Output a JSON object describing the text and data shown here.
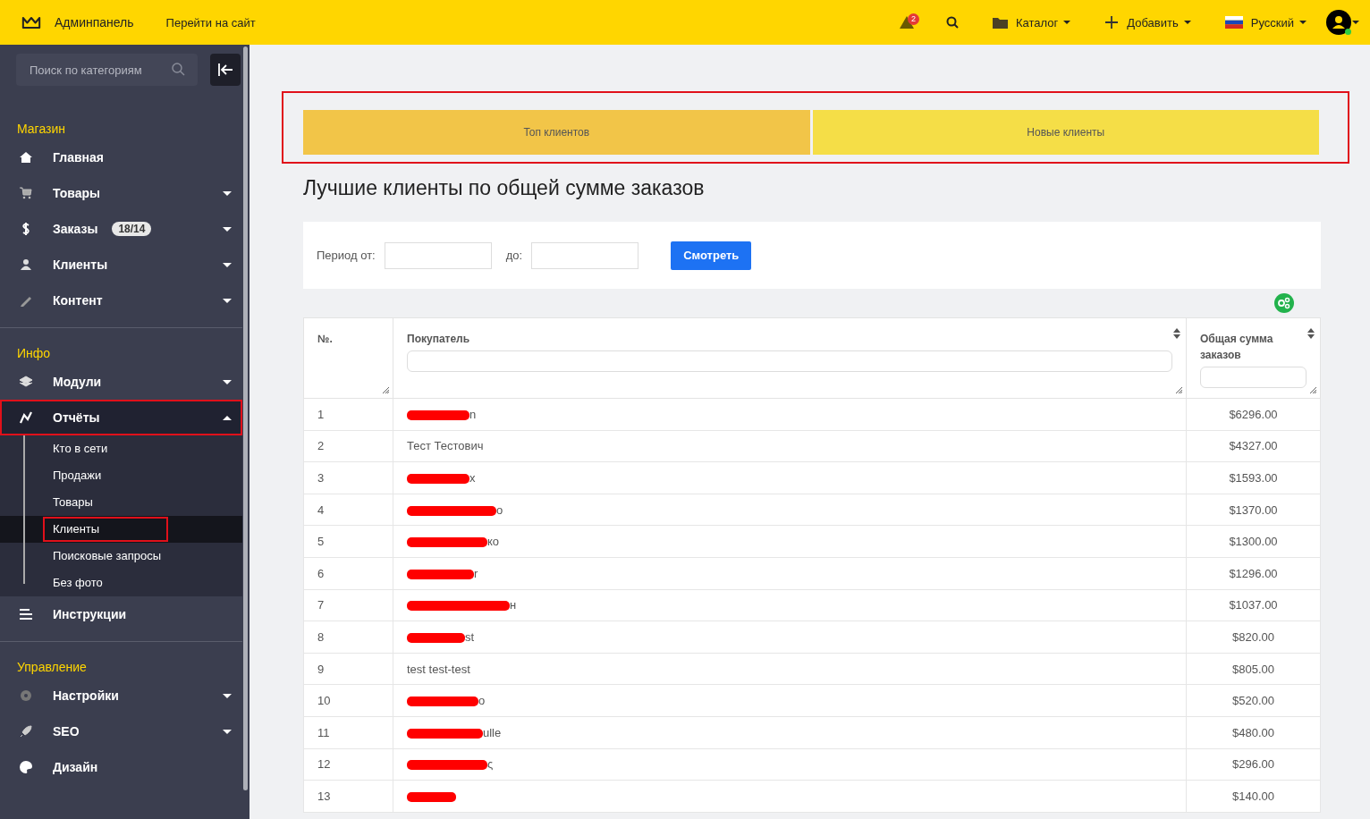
{
  "topbar": {
    "brand": "Админпанель",
    "site_link": "Перейти на сайт",
    "alerts_count": "2",
    "menus": [
      {
        "kind": "catalog",
        "label": "Каталог"
      },
      {
        "kind": "add",
        "label": "Добавить"
      },
      {
        "kind": "language",
        "label": "Русский"
      }
    ],
    "user_online": true
  },
  "sidebar": {
    "search_placeholder": "Поиск по категориям",
    "sections": [
      {
        "title": "Магазин",
        "items": [
          {
            "label": "Главная",
            "has_caret": false,
            "expanded": false,
            "annotated": false
          },
          {
            "label": "Товары",
            "has_caret": true,
            "expanded": false,
            "annotated": false
          },
          {
            "label": "Заказы",
            "badge": "18/14",
            "has_caret": true,
            "expanded": false,
            "annotated": false
          },
          {
            "label": "Клиенты",
            "has_caret": true,
            "expanded": false,
            "annotated": false
          },
          {
            "label": "Контент",
            "has_caret": true,
            "expanded": false,
            "annotated": false
          }
        ]
      },
      {
        "title": "Инфо",
        "items": [
          {
            "label": "Модули",
            "has_caret": true,
            "expanded": false,
            "annotated": false
          },
          {
            "label": "Отчёты",
            "has_caret": true,
            "expanded": true,
            "annotated": true,
            "children": [
              {
                "label": "Кто в сети",
                "selected": false,
                "annotated": false
              },
              {
                "label": "Продажи",
                "selected": false,
                "annotated": false
              },
              {
                "label": "Товары",
                "selected": false,
                "annotated": false
              },
              {
                "label": "Клиенты",
                "selected": true,
                "annotated": true
              },
              {
                "label": "Поисковые запросы",
                "selected": false,
                "annotated": false
              },
              {
                "label": "Без фото",
                "selected": false,
                "annotated": false
              }
            ]
          },
          {
            "label": "Инструкции",
            "has_caret": false,
            "expanded": false,
            "annotated": false
          }
        ]
      },
      {
        "title": "Управление",
        "items": [
          {
            "label": "Настройки",
            "has_caret": true,
            "expanded": false,
            "annotated": false
          },
          {
            "label": "SEO",
            "has_caret": true,
            "expanded": false,
            "annotated": false
          },
          {
            "label": "Дизайн",
            "has_caret": false,
            "expanded": false,
            "annotated": false
          }
        ]
      }
    ]
  },
  "tabs_annotated": true,
  "tabs": [
    {
      "label": "Топ клиентов",
      "selected": true
    },
    {
      "label": "Новые клиенты",
      "selected": false
    }
  ],
  "heading": "Лучшие клиенты по общей сумме заказов",
  "filter": {
    "from_label": "Период от:",
    "to_label": "до:",
    "button": "Смотреть"
  },
  "table": {
    "columns": [
      {
        "label": "№.",
        "sortable": false,
        "filter": false
      },
      {
        "label": "Покупатель",
        "sortable": true,
        "filter": true
      },
      {
        "label": "Общая сумма заказов",
        "sortable": true,
        "filter": true
      }
    ],
    "rows": [
      {
        "num": "1",
        "customer": "n",
        "redacted": true,
        "total": "$6296.00"
      },
      {
        "num": "2",
        "customer": "Тест Тестович",
        "redacted": false,
        "total": "$4327.00"
      },
      {
        "num": "3",
        "customer": "x",
        "redacted": true,
        "total": "$1593.00"
      },
      {
        "num": "4",
        "customer": "o",
        "redacted": true,
        "total": "$1370.00"
      },
      {
        "num": "5",
        "customer": "ко",
        "redacted": true,
        "total": "$1300.00"
      },
      {
        "num": "6",
        "customer": "r",
        "redacted": true,
        "total": "$1296.00"
      },
      {
        "num": "7",
        "customer": "н",
        "redacted": true,
        "total": "$1037.00"
      },
      {
        "num": "8",
        "customer": "st",
        "redacted": true,
        "total": "$820.00"
      },
      {
        "num": "9",
        "customer": "test test-test",
        "redacted": false,
        "total": "$805.00"
      },
      {
        "num": "10",
        "customer": "o",
        "redacted": true,
        "total": "$520.00"
      },
      {
        "num": "11",
        "customer": "ulle",
        "redacted": true,
        "total": "$480.00"
      },
      {
        "num": "12",
        "customer": "ς",
        "redacted": true,
        "total": "$296.00"
      },
      {
        "num": "13",
        "customer": "",
        "redacted": true,
        "total": "$140.00"
      }
    ]
  }
}
